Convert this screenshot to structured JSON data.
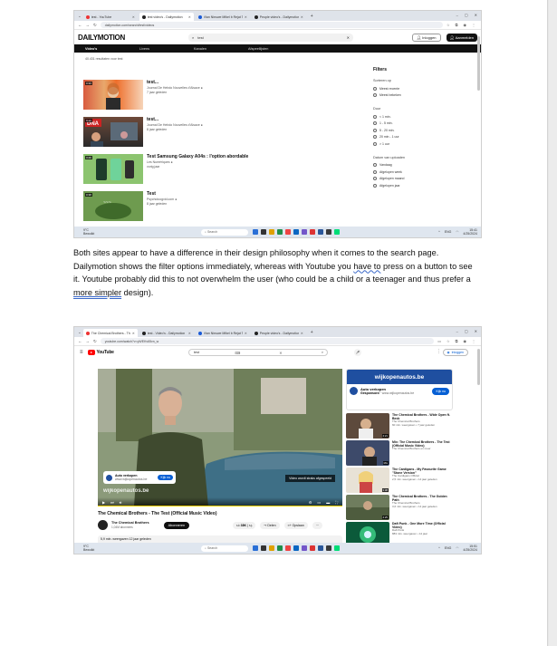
{
  "screenshot1": {
    "tabs": [
      {
        "label": "test - YouTube",
        "icon": "youtube-favicon"
      },
      {
        "label": "test video's - Dailymotion",
        "icon": "dailymotion-favicon"
      },
      {
        "label": "Vlan Nieuwe Mfkel b Rejat Tm...",
        "icon": "vw-favicon"
      },
      {
        "label": "People video's - Dailymotion",
        "icon": "dailymotion-favicon"
      }
    ],
    "url": "dailymotion.com/search/test/videos",
    "logo": "DAILYMOTION",
    "search_query": "test",
    "login": "Inloggen",
    "signup": "Aanmelden",
    "nav_tabs": [
      "Video's",
      "Livens",
      "Kanalen",
      "Afspeellijsten"
    ],
    "results_count": "40.431 resultaten voor test",
    "results": [
      {
        "duration": "0:33",
        "title": "test...",
        "channel": "Journal De Hebdo Nouvelles d'Alsace",
        "age": "7 jaar geleden"
      },
      {
        "duration": "0:12",
        "title": "test...",
        "channel": "Journal De Hebdo Nouvelles d'Alsace",
        "age": "8 jaar geleden"
      },
      {
        "duration": "3:26",
        "title": "Test Samsung Galaxy A04s : l'option abordable",
        "channel": "Les Numériques",
        "age": "vorig jaar"
      },
      {
        "duration": "0:38",
        "title": "Test",
        "channel": "Psycholoogvid.com",
        "age": "8 jaar geleden"
      }
    ],
    "filters": {
      "heading": "Filters",
      "groups": [
        {
          "label": "Sorteren op",
          "options": [
            "Meest recente",
            "Meest bekeken"
          ]
        },
        {
          "label": "Duur",
          "options": [
            "< 1 min.",
            "1 - 5 min.",
            "5 - 20 min.",
            "20 min - 1 uur",
            "> 1 uur"
          ]
        },
        {
          "label": "Datum van uploaden",
          "options": [
            "Vandaag",
            "Afgelopen week",
            "Afgelopen maand",
            "Afgelopen jaar"
          ]
        }
      ]
    },
    "taskbar": {
      "weather_temp": "9°C",
      "weather_desc": "Bewolkt",
      "search": "Search",
      "lang": "ENG",
      "time": "15:41",
      "date": "4/25/2024"
    }
  },
  "essay": {
    "text1": "Both sites appear to have a difference in their design philosophy when it comes to the search page. Dailymotion shows the filter options immediately, whereas with Youtube you ",
    "marked1": "have to",
    "text2": " press on a button to see it. Youtube probably did this to not overwhelm the user (who could be a child or a teenager and thus prefer a ",
    "marked2": "more simpler",
    "text3": " design)."
  },
  "screenshot2": {
    "tabs": [
      {
        "label": "The Chemical Brothers - The Te...",
        "icon": "youtube-favicon"
      },
      {
        "label": "test - Video's - Dailymotion",
        "icon": "dailymotion-favicon"
      },
      {
        "label": "Vlan Nieuwe Mfkel b Rejat Tm...",
        "icon": "vw-favicon"
      },
      {
        "label": "People video's - Dailymotion",
        "icon": "dailymotion-favicon"
      }
    ],
    "url": "youtube.com/watch?v=yWEKv65vn_w",
    "logo": "YouTube",
    "search_query": "test",
    "signin": "Inloggen",
    "video_title": "The Chemical Brothers - The Test (Official Music Video)",
    "channel": "The Chemical Brothers",
    "subscribers": "1,04M abonnees",
    "subscribe": "Abonneren",
    "likes": "38K",
    "share": "Delen",
    "save": "Opslaan",
    "views": "5,9 mln. weergaven  12 jaar geleden",
    "overlay_ad_title": "Auto verkopen",
    "overlay_ad_url": "www.wijkopenautos.be",
    "overlay_ad_button": "Kijk nu",
    "skip": "Video wordt straks afgespeeld",
    "watermark": "wijkopenautos.be",
    "ad": {
      "banner": "wijkopenautos.be",
      "title": "Auto verkopen",
      "label": "Gesponsord",
      "url": "www.wijkopenautos.be",
      "button": "Kijk nu"
    },
    "suggestions": [
      {
        "title": "The Chemical Brothers - Wide Open ft. Beck",
        "channel": "The Chemical Brothers",
        "meta": "60 mln. weergaven • 7 jaar geleden",
        "duration": "4:21"
      },
      {
        "title": "Mix: The Chemical Brothers - The Test (Official Music Video)",
        "channel": "The Chemical Brothers en meer",
        "meta": "",
        "duration": "Mix"
      },
      {
        "title": "The Cardigans - My Favourite Game \"Stone Version\"",
        "channel": "The Cardigans Official",
        "meta": "2,5 mln. weergaven • 14 jaar geleden",
        "duration": "3:38"
      },
      {
        "title": "The Chemical Brothers - The Golden Path",
        "channel": "The Chemical Brothers",
        "meta": "3,6 mln. weergaven • 14 jaar geleden",
        "duration": "4:25"
      },
      {
        "title": "Daft Punk - One More Time (Official Video)",
        "channel": "Daft Punk",
        "meta": "883 mln. weergaven • 14 jaar",
        "duration": ""
      }
    ],
    "taskbar": {
      "weather_temp": "9°C",
      "weather_desc": "Bewolkt",
      "search": "Search",
      "lang": "ENG",
      "time": "15:51",
      "date": "4/25/2024"
    }
  },
  "colors": {
    "youtube_red": "#ff0000",
    "dailymotion_black": "#0d0d0d",
    "ad_blue": "#1f4fa0",
    "link_blue": "#065fd4"
  }
}
